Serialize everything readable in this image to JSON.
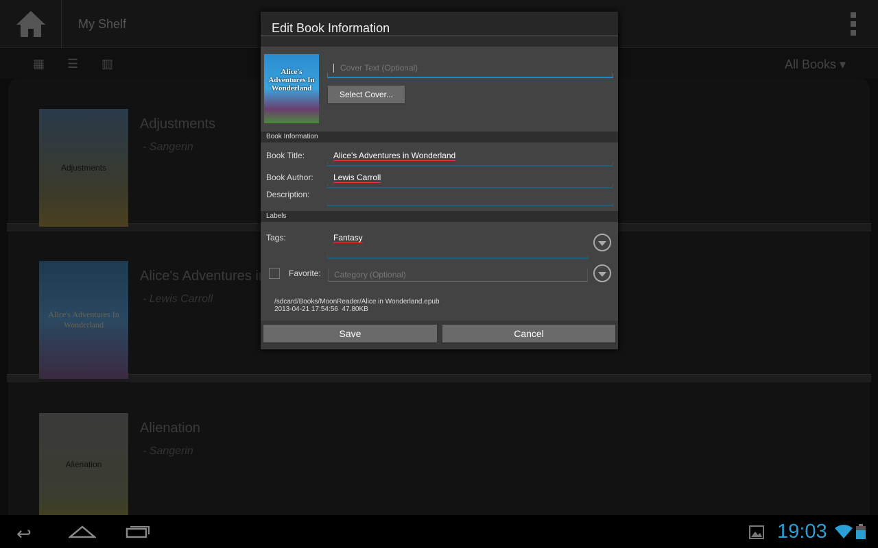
{
  "app": {
    "title": "My Shelf",
    "filter": "All Books"
  },
  "books": [
    {
      "title": "Adjustments",
      "author": "- Sangerin",
      "cover_text": "Adjustments"
    },
    {
      "title": "Alice's Adventures in Wonderland",
      "author": "- Lewis Carroll",
      "cover_text": "Alice's Adventures In Wonderland"
    },
    {
      "title": "Alienation",
      "author": "- Sangerin",
      "cover_text": "Alienation"
    }
  ],
  "dialog": {
    "title": "Edit Book Information",
    "cover_label": "Alice's Adventures In Wonderland",
    "cover_text_placeholder": "Cover Text (Optional)",
    "select_cover": "Select Cover...",
    "section_book": "Book Information",
    "book_title_label": "Book Title:",
    "book_title": "Alice's Adventures in Wonderland",
    "book_author_label": "Book Author:",
    "book_author": "Lewis Carroll",
    "description_label": "Description:",
    "section_labels": "Labels",
    "tags_label": "Tags:",
    "tags": "Fantasy",
    "favorite_label": "Favorite:",
    "category_placeholder": "Category (Optional)",
    "file_path": "/sdcard/Books/MoonReader/Alice in Wonderland.epub",
    "file_info": "2013-04-21 17:54:56  47.80KB",
    "save": "Save",
    "cancel": "Cancel"
  },
  "status": {
    "time": "19:03",
    "accent": "#2a9fd6"
  }
}
